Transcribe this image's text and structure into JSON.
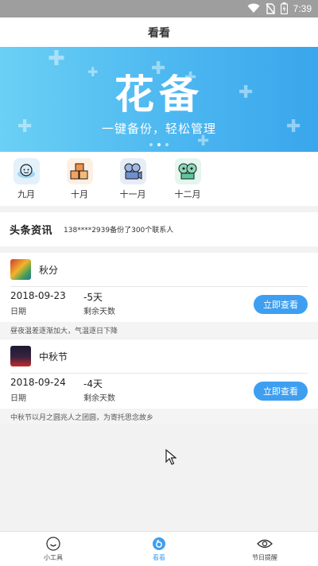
{
  "status_bar": {
    "time": "7:39"
  },
  "header": {
    "title": "看看"
  },
  "banner": {
    "title": "花备",
    "subtitle": "一键备份，轻松管理",
    "dots": 3,
    "active_dot": 1
  },
  "months": [
    {
      "label": "九月",
      "icon": "emoji-face-icon",
      "color": "#e3f1fb"
    },
    {
      "label": "十月",
      "icon": "boxes-icon",
      "color": "#fdf0e3"
    },
    {
      "label": "十一月",
      "icon": "camera-reel-icon",
      "color": "#e7edf7"
    },
    {
      "label": "十二月",
      "icon": "film-reel-icon",
      "color": "#e4f6ee"
    }
  ],
  "news": {
    "brand": "头条资讯",
    "text": "138****2939备份了300个联系人"
  },
  "cards": [
    {
      "name": "秋分",
      "date": "2018-09-23",
      "date_label": "日期",
      "days": "-5天",
      "days_label": "剩余天数",
      "button": "立即查看",
      "desc": "昼夜温差逐渐加大，气温逐日下降"
    },
    {
      "name": "中秋节",
      "date": "2018-09-24",
      "date_label": "日期",
      "days": "-4天",
      "days_label": "剩余天数",
      "button": "立即查看",
      "desc": "中秋节以月之圆兆人之团圆，为寄托思念故乡"
    }
  ],
  "tabs": [
    {
      "label": "小工具",
      "icon": "smiley-icon"
    },
    {
      "label": "看看",
      "icon": "look-icon",
      "active": true
    },
    {
      "label": "节日提醒",
      "icon": "eye-icon"
    }
  ],
  "colors": {
    "accent": "#3e9ff0",
    "banner": "#4cb7f0"
  }
}
